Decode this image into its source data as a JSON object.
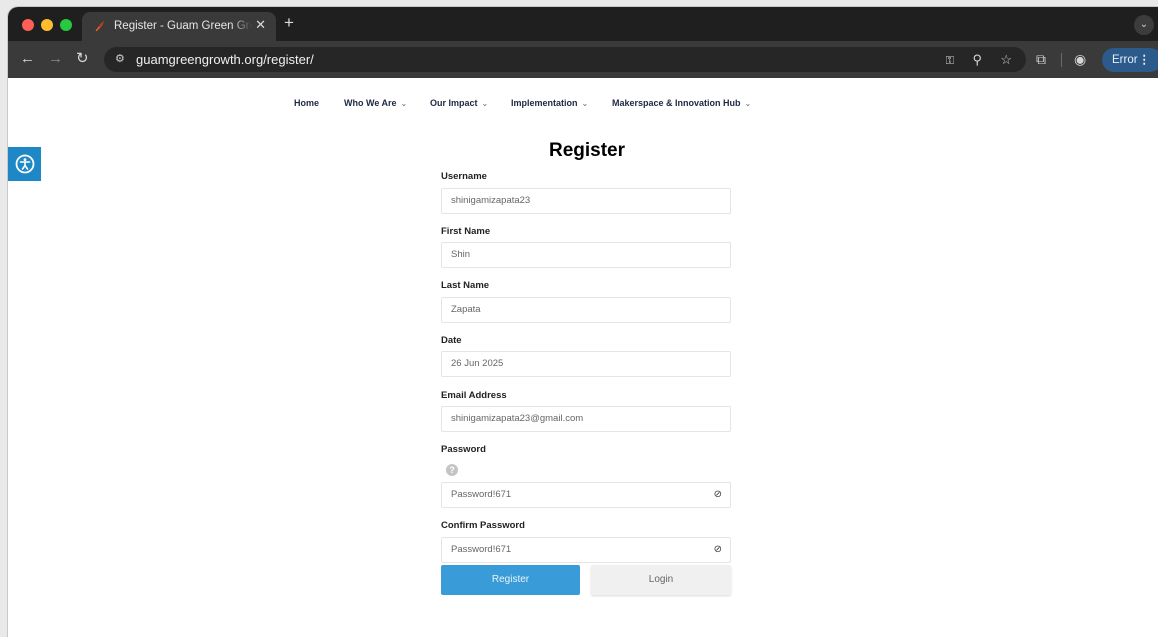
{
  "browser": {
    "tab_title": "Register - Guam Green Growth",
    "tab_close": "✕",
    "new_tab": "+",
    "url": "guamgreengrowth.org/register/",
    "error_label": "Error",
    "icons": [
      "back-icon",
      "forward-icon",
      "reload-icon",
      "site-info-icon",
      "key-icon",
      "zoom-icon",
      "star-icon",
      "extensions-icon",
      "profile-icon",
      "menu-icon"
    ]
  },
  "site_nav": {
    "items": [
      {
        "label": "Home",
        "has_chevron": false
      },
      {
        "label": "Who We Are",
        "has_chevron": true
      },
      {
        "label": "Our Impact",
        "has_chevron": true
      },
      {
        "label": "Implementation",
        "has_chevron": true
      },
      {
        "label": "Makerspace & Innovation Hub",
        "has_chevron": true
      }
    ]
  },
  "form": {
    "title": "Register",
    "fields": [
      {
        "label": "Username",
        "value": "shinigamizapata23"
      },
      {
        "label": "First Name",
        "value": "Shin"
      },
      {
        "label": "Last Name",
        "value": "Zapata"
      },
      {
        "label": "Date",
        "value": "26 Jun 2025"
      },
      {
        "label": "Email Address",
        "value": "shinigamizapata23@gmail.com"
      },
      {
        "label": "Password",
        "value": "Password!671"
      },
      {
        "label": "Confirm Password",
        "value": "Password!671"
      }
    ],
    "help_glyph": "?",
    "register_button": "Register",
    "login_button": "Login"
  },
  "colors": {
    "accent": "#3a9bd9",
    "accessibility": "#1e88c7",
    "nav_text": "#1c2942"
  }
}
